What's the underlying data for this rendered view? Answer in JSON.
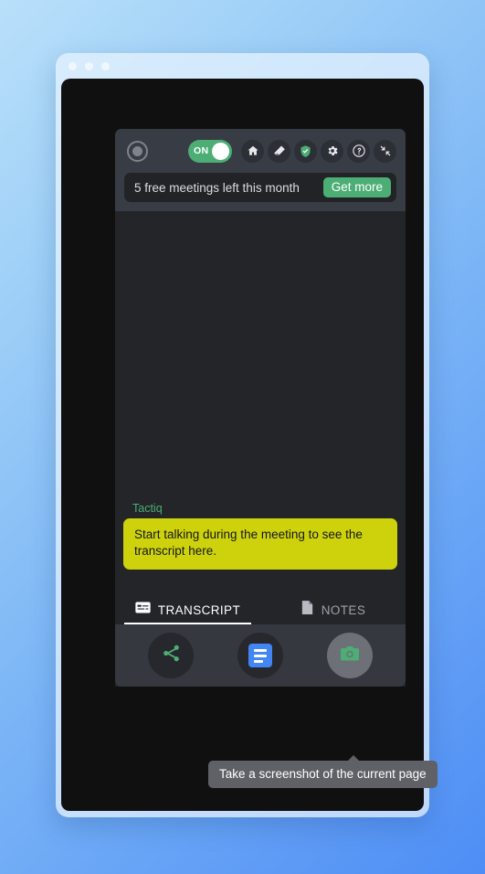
{
  "window": {
    "traffic_lights": [
      "close",
      "minimize",
      "maximize"
    ]
  },
  "panel": {
    "header": {
      "record_button_icon": "record-circle-icon",
      "toggle": {
        "label": "ON",
        "state": "on",
        "color": "#4cae74"
      },
      "icons": [
        {
          "name": "home-icon",
          "title": "Home"
        },
        {
          "name": "eraser-icon",
          "title": "Clear"
        },
        {
          "name": "shield-check-icon",
          "title": "Privacy",
          "color": "#4cae74"
        },
        {
          "name": "gear-icon",
          "title": "Settings"
        },
        {
          "name": "help-circle-icon",
          "title": "Help"
        },
        {
          "name": "collapse-arrows-icon",
          "title": "Minimize"
        }
      ]
    },
    "quota": {
      "text": "5 free meetings left this month",
      "cta_label": "Get more",
      "cta_color": "#4cae74"
    },
    "transcript": {
      "speaker": "Tactiq",
      "speaker_color": "#4cae74",
      "callout_text": "Start talking during the meeting to see the transcript here.",
      "callout_color": "#cdd20c"
    },
    "tabs": [
      {
        "label": "TRANSCRIPT",
        "icon": "transcript-icon",
        "active": true
      },
      {
        "label": "NOTES",
        "icon": "notes-page-icon",
        "active": false
      }
    ],
    "actions": [
      {
        "name": "share-button",
        "icon": "share-icon",
        "color": "#4cae74",
        "hovered": false
      },
      {
        "name": "google-docs-button",
        "icon": "google-docs-icon",
        "color": "#4285f4",
        "hovered": false
      },
      {
        "name": "screenshot-button",
        "icon": "camera-icon",
        "color": "#4cae74",
        "hovered": true
      }
    ],
    "tooltip": {
      "text": "Take a screenshot of the current page"
    }
  }
}
